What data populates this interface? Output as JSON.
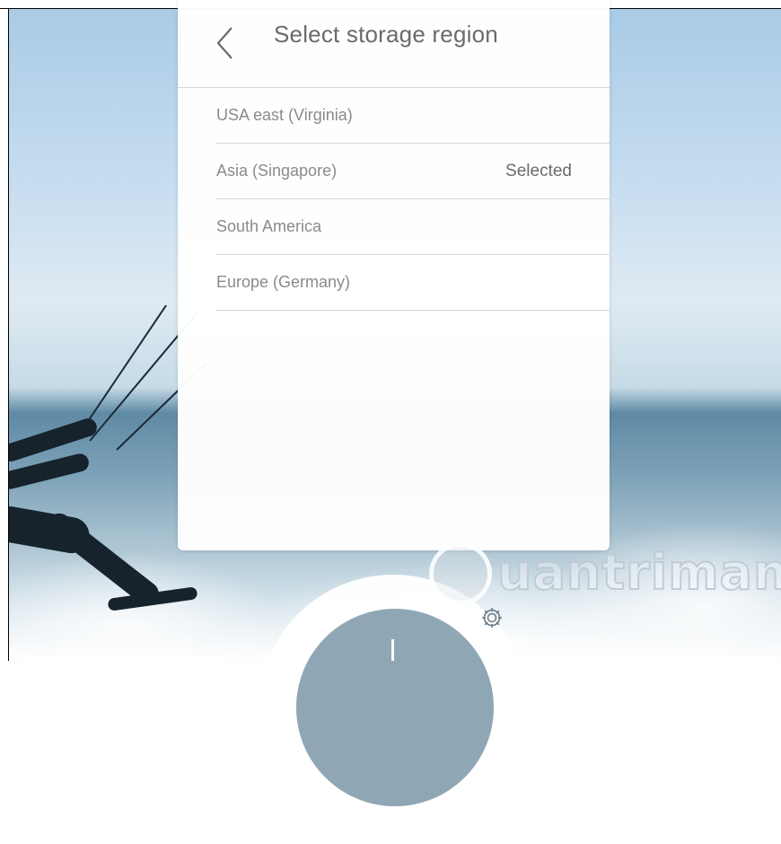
{
  "panel": {
    "title": "Select storage region",
    "back_icon": "chevron-left-icon"
  },
  "regions": [
    {
      "name": "USA east (Virginia)",
      "status": ""
    },
    {
      "name": "Asia (Singapore)",
      "status": "Selected"
    },
    {
      "name": "South America",
      "status": ""
    },
    {
      "name": "Europe (Germany)",
      "status": ""
    }
  ],
  "settings_icon": "gear-icon",
  "watermark": {
    "text": "uantrimang",
    "icon": "lightbulb-icon"
  },
  "colors": {
    "panel_bg": "#ffffff",
    "title_text": "#6b6b6b",
    "item_text": "#8a8a8a",
    "divider": "#d6d6d6"
  }
}
